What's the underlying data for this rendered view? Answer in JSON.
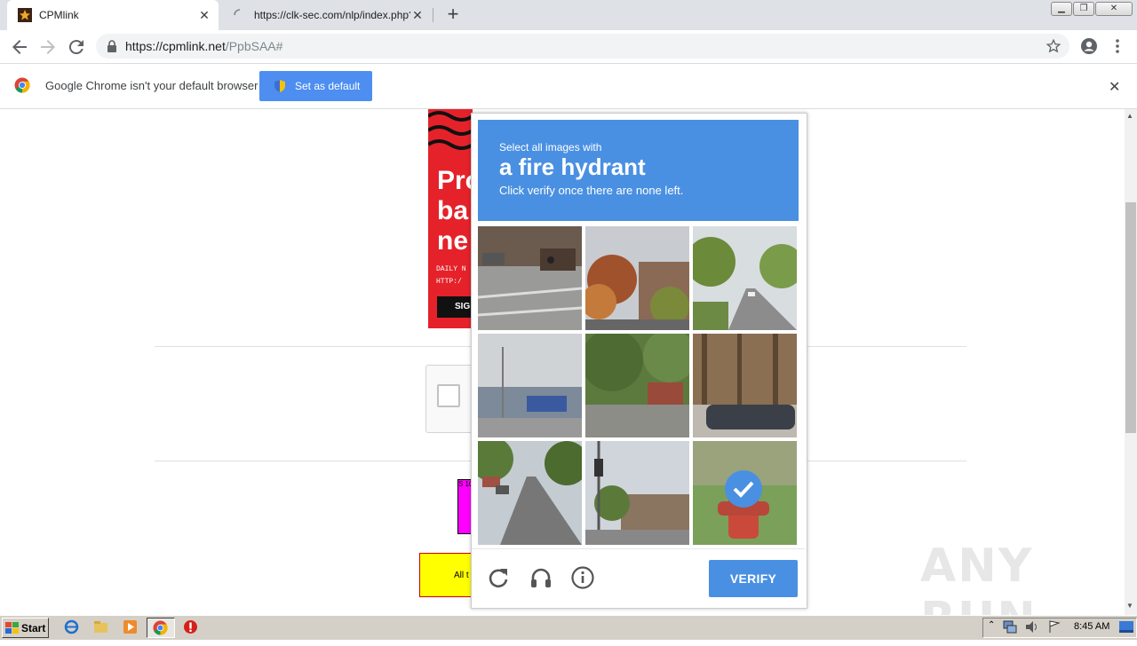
{
  "browser": {
    "tabs": [
      {
        "title": "CPMlink",
        "active": true,
        "favicon": "star-favicon"
      },
      {
        "title": "https://clk-sec.com/nlp/index.php?a",
        "active": false,
        "favicon": "loading-spinner-icon"
      }
    ],
    "new_tab_label": "+",
    "address": {
      "host": "https://cpmlink.net",
      "path": "/PpbSAA#"
    }
  },
  "infobar": {
    "message": "Google Chrome isn't your default browser",
    "button_label": "Set as default"
  },
  "page": {
    "ad": {
      "headline_lines": [
        "Pro",
        "ba",
        "ne"
      ],
      "small_lines": [
        "DAILY N",
        "HTTP:/"
      ],
      "button_label": "SIG"
    },
    "magenta_text": "S\n10",
    "yellow_text": "All t"
  },
  "captcha": {
    "instruction_line1": "Select all images with",
    "target": "a fire hydrant",
    "instruction_line3": "Click verify once there are none left.",
    "verify_label": "VERIFY",
    "tiles": [
      {
        "subject": "street crossing with cyclist",
        "selected": false
      },
      {
        "subject": "autumn trees and building",
        "selected": false
      },
      {
        "subject": "tree-lined road",
        "selected": false
      },
      {
        "subject": "street lamp and building",
        "selected": false
      },
      {
        "subject": "trees and house",
        "selected": false
      },
      {
        "subject": "parked car and woods",
        "selected": false
      },
      {
        "subject": "residential street with cars",
        "selected": false
      },
      {
        "subject": "intersection with traffic lights",
        "selected": false
      },
      {
        "subject": "fire hydrant on grass",
        "selected": true
      }
    ],
    "colors": {
      "accent": "#4a90e2"
    }
  },
  "watermark": "ANY RUN",
  "taskbar": {
    "start_label": "Start",
    "clock": "8:45 AM"
  }
}
